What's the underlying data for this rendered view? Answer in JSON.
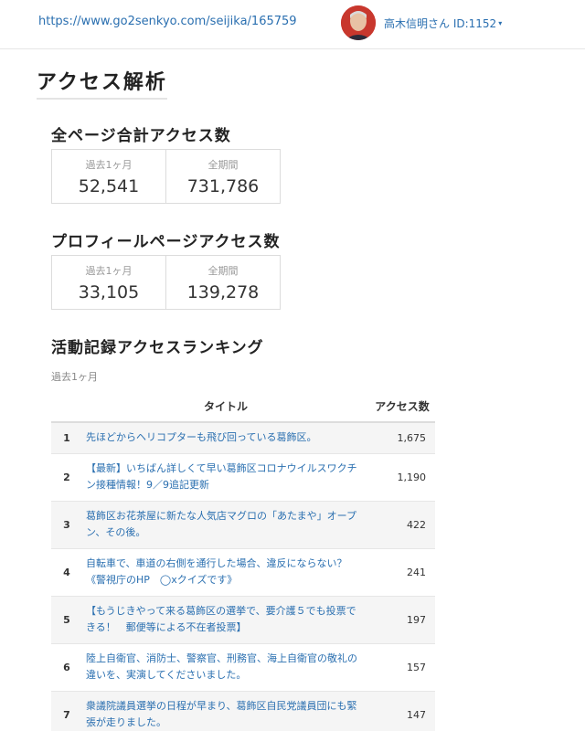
{
  "header": {
    "url": "https://www.go2senkyo.com/seijika/165759",
    "user_label": "高木信明さん ID:1152",
    "caret": "▾"
  },
  "page_title": "アクセス解析",
  "total_access": {
    "title": "全ページ合計アクセス数",
    "past_month_label": "過去1ヶ月",
    "past_month_value": "52,541",
    "all_time_label": "全期間",
    "all_time_value": "731,786"
  },
  "profile_access": {
    "title": "プロフィールページアクセス数",
    "past_month_label": "過去1ヶ月",
    "past_month_value": "33,105",
    "all_time_label": "全期間",
    "all_time_value": "139,278"
  },
  "ranking": {
    "title": "活動記録アクセスランキング",
    "period": "過去1ヶ月",
    "col_title": "タイトル",
    "col_count": "アクセス数",
    "rows": [
      {
        "rank": "1",
        "title": "先ほどからヘリコプターも飛び回っている葛飾区。",
        "count": "1,675"
      },
      {
        "rank": "2",
        "title": "【最新】いちばん詳しくて早い葛飾区コロナウイルスワクチン接種情報！9／9追記更新",
        "count": "1,190"
      },
      {
        "rank": "3",
        "title": "葛飾区お花茶屋に新たな人気店マグロの「あたまや」オープン、その後。",
        "count": "422"
      },
      {
        "rank": "4",
        "title": "自転車で、車道の右側を通行した場合、違反にならない？《警視庁のHP　◯xクイズです》",
        "count": "241"
      },
      {
        "rank": "5",
        "title": "【もうじきやって来る葛飾区の選挙で、要介護５でも投票できる！　郵便等による不在者投票】",
        "count": "197"
      },
      {
        "rank": "6",
        "title": "陸上自衛官、消防士、警察官、刑務官、海上自衛官の敬礼の違いを、実演してくださいました。",
        "count": "157"
      },
      {
        "rank": "7",
        "title": "衆議院議員選挙の日程が早まり、葛飾区自民党議員団にも緊張が走りました。",
        "count": "147"
      }
    ]
  }
}
